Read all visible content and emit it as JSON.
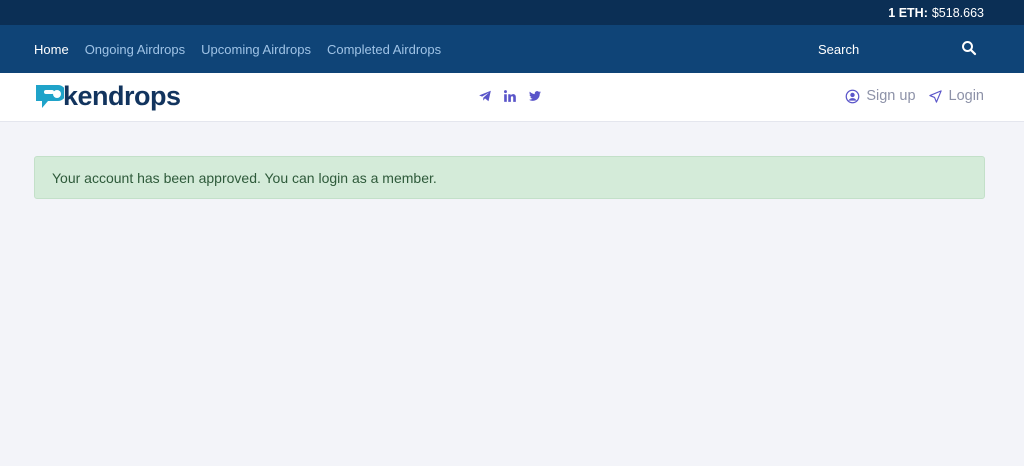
{
  "topbar": {
    "eth_label": "1 ETH:",
    "eth_price": "$518.663"
  },
  "nav": {
    "items": [
      {
        "label": "Home",
        "active": true
      },
      {
        "label": "Ongoing Airdrops",
        "active": false
      },
      {
        "label": "Upcoming Airdrops",
        "active": false
      },
      {
        "label": "Completed Airdrops",
        "active": false
      }
    ],
    "search_placeholder": "Search"
  },
  "header": {
    "logo_text": "kendrops",
    "signup_label": "Sign up",
    "login_label": "Login"
  },
  "alert": {
    "message": "Your account has been approved. You can login as a member."
  },
  "colors": {
    "topbar_bg": "#0b2f55",
    "nav_bg": "#0f4477",
    "brand_teal": "#1fa3c9",
    "brand_navy": "#12345e",
    "social_purple": "#5a55c9",
    "alert_bg": "#d4ebd9"
  }
}
